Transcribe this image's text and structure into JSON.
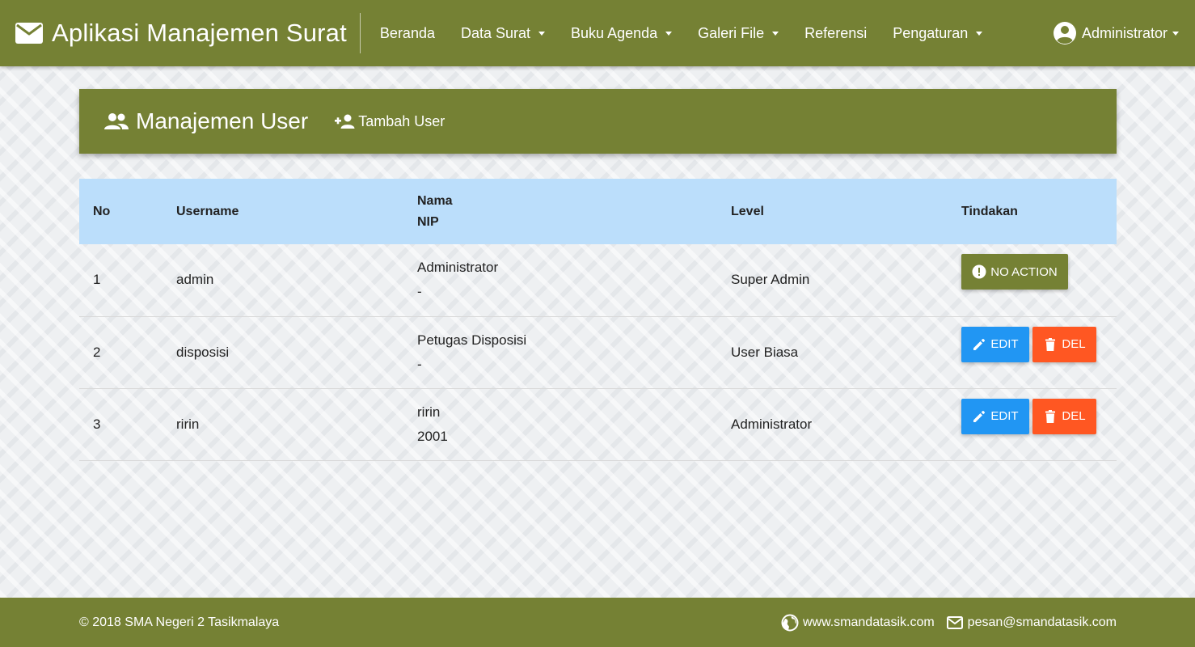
{
  "navbar": {
    "brand_icon": "mail-icon",
    "title": "Aplikasi Manajemen Surat",
    "items": [
      {
        "label": "Beranda",
        "dropdown": false
      },
      {
        "label": "Data Surat",
        "dropdown": true
      },
      {
        "label": "Buku Agenda",
        "dropdown": true
      },
      {
        "label": "Galeri File",
        "dropdown": true
      },
      {
        "label": "Referensi",
        "dropdown": false
      },
      {
        "label": "Pengaturan",
        "dropdown": true
      }
    ],
    "user": {
      "icon": "account-circle-icon",
      "label": "Administrator"
    }
  },
  "page_header": {
    "icon": "people-icon",
    "title": "Manajemen User",
    "add_button": {
      "icon": "person-add-icon",
      "label": "Tambah User"
    }
  },
  "table": {
    "headers": {
      "no": "No",
      "username": "Username",
      "nama": "Nama",
      "nip": "NIP",
      "level": "Level",
      "tindakan": "Tindakan"
    },
    "rows": [
      {
        "no": "1",
        "username": "admin",
        "nama": "Administrator",
        "nip": "-",
        "level": "Super Admin",
        "actions": [
          {
            "type": "no-action",
            "label": "NO ACTION",
            "icon": "alert-circle-icon"
          }
        ]
      },
      {
        "no": "2",
        "username": "disposisi",
        "nama": "Petugas Disposisi",
        "nip": "-",
        "level": "User Biasa",
        "actions": [
          {
            "type": "edit",
            "label": "EDIT",
            "icon": "pencil-icon"
          },
          {
            "type": "del",
            "label": "DEL",
            "icon": "trash-icon"
          }
        ]
      },
      {
        "no": "3",
        "username": "ririn",
        "nama": "ririn",
        "nip": "2001",
        "level": "Administrator",
        "actions": [
          {
            "type": "edit",
            "label": "EDIT",
            "icon": "pencil-icon"
          },
          {
            "type": "del",
            "label": "DEL",
            "icon": "trash-icon"
          }
        ]
      }
    ]
  },
  "footer": {
    "copyright": "© 2018 SMA Negeri 2 Tasikmalaya",
    "website": {
      "icon": "globe-icon",
      "label": "www.smandatasik.com"
    },
    "email": {
      "icon": "mail-outline-icon",
      "label": "pesan@smandatasik.com"
    }
  },
  "colors": {
    "primary": "#758134",
    "table_header": "#bbdefb",
    "edit_button": "#2196f3",
    "delete_button": "#ff5722"
  }
}
